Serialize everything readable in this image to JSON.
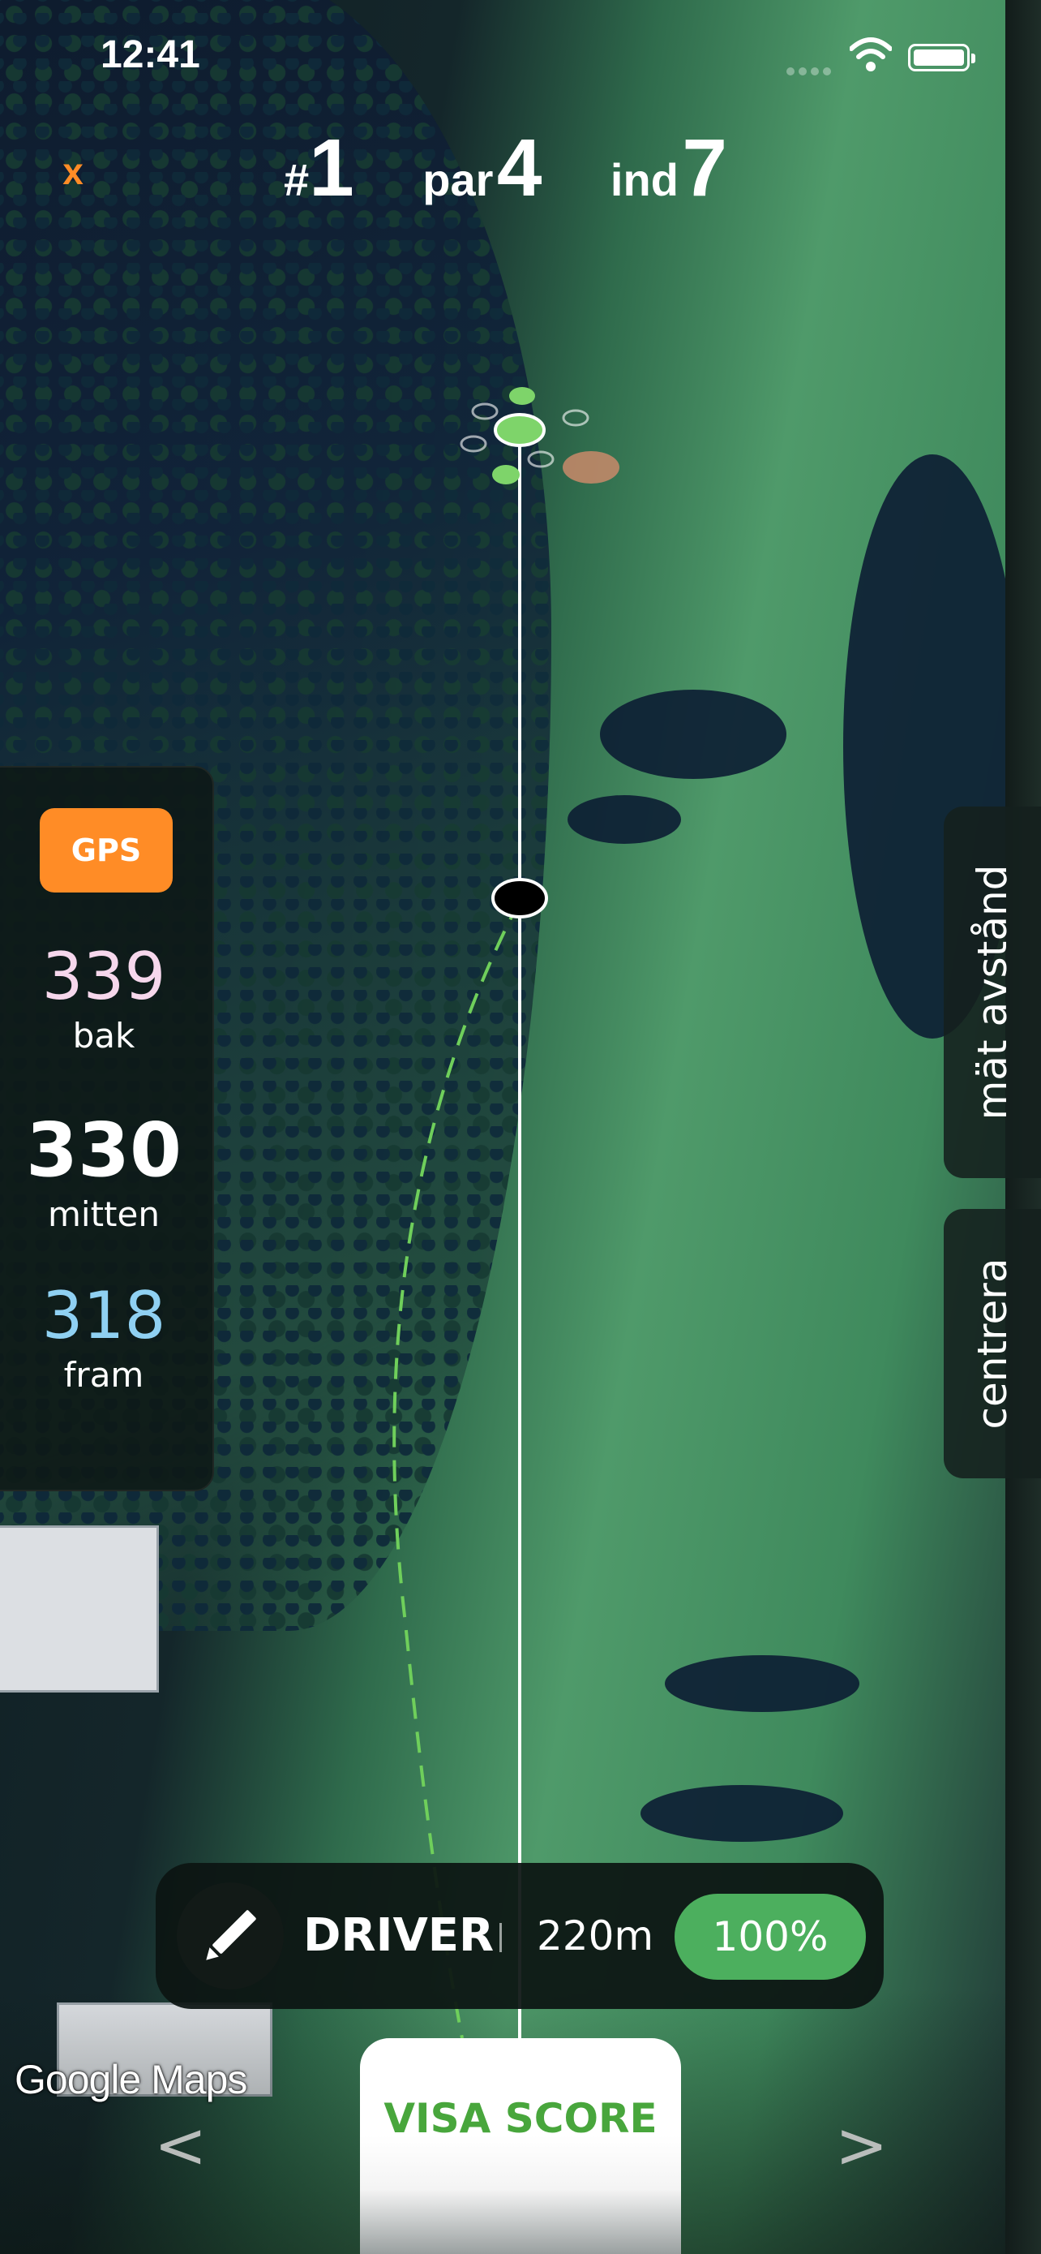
{
  "status_bar": {
    "time": "12:41"
  },
  "header": {
    "close_label": "x",
    "hole_prefix": "#",
    "hole_number": "1",
    "par_label": "par",
    "par_value": "4",
    "index_label": "ind",
    "index_value": "7"
  },
  "distances": {
    "gps_label": "GPS",
    "back": {
      "value": "339",
      "label": "bak"
    },
    "middle": {
      "value": "330",
      "label": "mitten"
    },
    "front": {
      "value": "318",
      "label": "fram"
    }
  },
  "side_tabs": {
    "measure_label": "mät avstånd",
    "center_label": "centrera"
  },
  "club_bar": {
    "club_name": "DRIVER",
    "club_distance": "220m",
    "power": "100%"
  },
  "map_attribution": "Google Maps",
  "score_button": "VISA SCORE",
  "nav": {
    "prev": "<",
    "next": ">"
  },
  "colors": {
    "accent_orange": "#ff8c26",
    "score_green": "#48a63c",
    "power_green": "#4caf5e",
    "back_pink": "#f6d7ec",
    "front_blue": "#8fd0f2"
  }
}
